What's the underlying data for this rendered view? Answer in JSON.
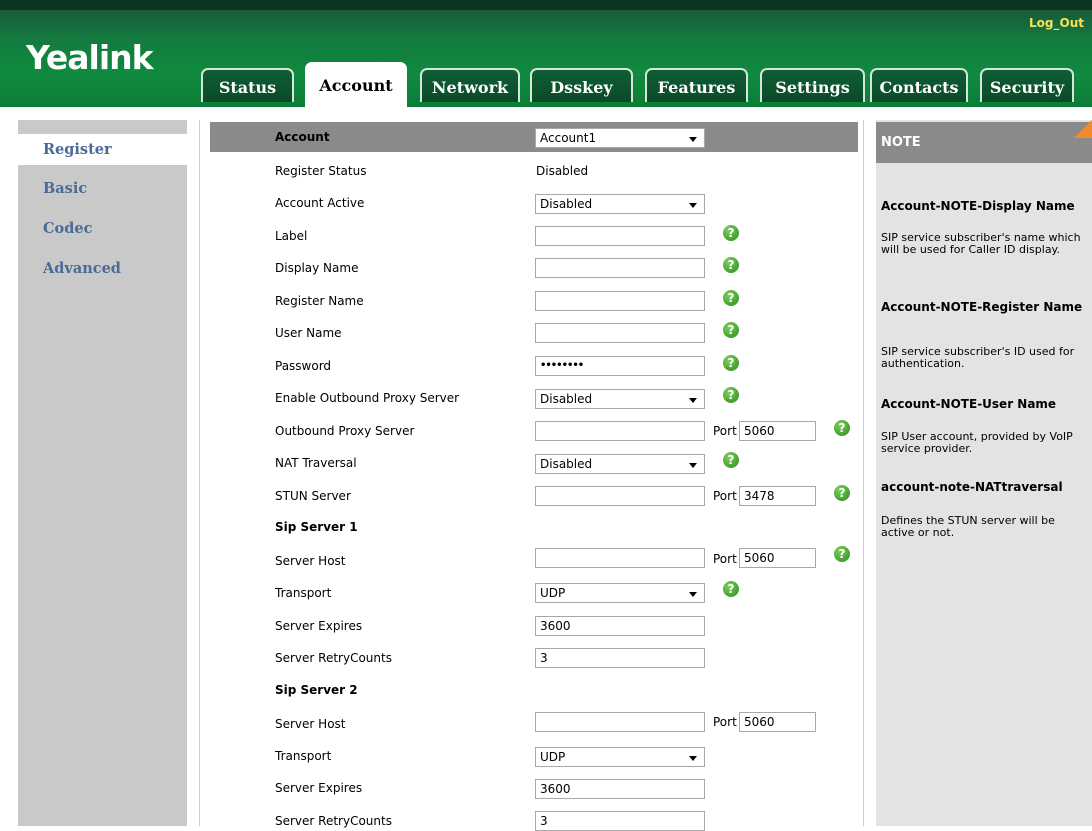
{
  "header": {
    "logo": "Yealink",
    "logout": "Log_Out",
    "tabs": [
      "Status",
      "Account",
      "Network",
      "Dsskey",
      "Features",
      "Settings",
      "Contacts",
      "Security"
    ],
    "active_tab": "Account"
  },
  "sidebar": {
    "items": [
      "Register",
      "Basic",
      "Codec",
      "Advanced"
    ],
    "active": "Register"
  },
  "form": {
    "account": {
      "label": "Account",
      "value": "Account1"
    },
    "register_status": {
      "label": "Register Status",
      "value": "Disabled"
    },
    "account_active": {
      "label": "Account Active",
      "value": "Disabled"
    },
    "label_field": {
      "label": "Label",
      "value": ""
    },
    "display_name": {
      "label": "Display Name",
      "value": ""
    },
    "register_name": {
      "label": "Register Name",
      "value": ""
    },
    "user_name": {
      "label": "User Name",
      "value": ""
    },
    "password": {
      "label": "Password",
      "value": "••••••••"
    },
    "enable_outbound_proxy": {
      "label": "Enable Outbound Proxy Server",
      "value": "Disabled"
    },
    "outbound_proxy": {
      "label": "Outbound Proxy Server",
      "value": "",
      "port_label": "Port",
      "port": "5060"
    },
    "nat_traversal": {
      "label": "NAT Traversal",
      "value": "Disabled"
    },
    "stun_server": {
      "label": "STUN Server",
      "value": "",
      "port_label": "Port",
      "port": "3478"
    },
    "sip_server_1": {
      "heading": "Sip Server 1",
      "server_host": {
        "label": "Server Host",
        "value": "",
        "port_label": "Port",
        "port": "5060"
      },
      "transport": {
        "label": "Transport",
        "value": "UDP"
      },
      "server_expires": {
        "label": "Server Expires",
        "value": "3600"
      },
      "server_retry": {
        "label": "Server RetryCounts",
        "value": "3"
      }
    },
    "sip_server_2": {
      "heading": "Sip Server 2",
      "server_host": {
        "label": "Server Host",
        "value": "",
        "port_label": "Port",
        "port": "5060"
      },
      "transport": {
        "label": "Transport",
        "value": "UDP"
      },
      "server_expires": {
        "label": "Server Expires",
        "value": "3600"
      },
      "server_retry": {
        "label": "Server RetryCounts",
        "value": "3"
      }
    },
    "help_glyph": "?"
  },
  "note": {
    "title": "NOTE",
    "entries": [
      {
        "heading": "Account-NOTE-Display Name",
        "text": "SIP service subscriber's name which will be used for Caller ID display."
      },
      {
        "heading": "Account-NOTE-Register Name",
        "text": "SIP service subscriber's ID used for authentication."
      },
      {
        "heading": "Account-NOTE-User Name",
        "text": "SIP User account, provided by VoIP service provider."
      },
      {
        "heading": "account-note-NATtraversal",
        "text": "Defines the STUN server will be active or not."
      }
    ]
  },
  "colors": {
    "header_green": "#0f8a3e",
    "logout_yellow": "#f3e25a",
    "nav_text": "#4a6a97",
    "bar_gray": "#8a8a8a",
    "help_green": "#2e8a22",
    "note_corner": "#f28a2a"
  }
}
